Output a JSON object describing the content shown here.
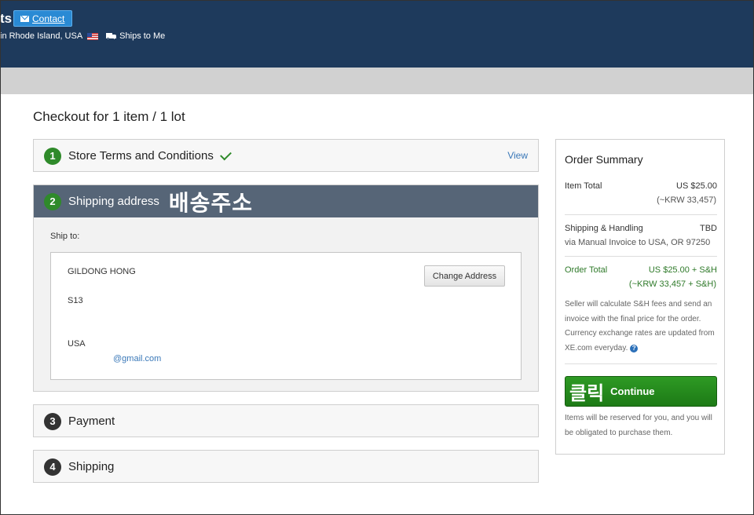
{
  "header": {
    "brand_fragment": "ts",
    "contact_label": "Contact",
    "location": "in Rhode Island, USA",
    "ships_to": "Ships to Me"
  },
  "page_title": "Checkout for 1 item / 1 lot",
  "steps": [
    {
      "number": "1",
      "title": "Store Terms and Conditions",
      "link": "View"
    },
    {
      "number": "2",
      "title": "Shipping address",
      "annotation": "배송주소"
    },
    {
      "number": "3",
      "title": "Payment"
    },
    {
      "number": "4",
      "title": "Shipping"
    }
  ],
  "shipping": {
    "ship_to_label": "Ship to:",
    "name": "GILDONG HONG",
    "line2": "S13",
    "country": "USA",
    "email": "@gmail.com",
    "change_button": "Change Address"
  },
  "summary": {
    "title": "Order Summary",
    "item_total_label": "Item Total",
    "item_total_value": "US $25.00",
    "item_total_krw": "(~KRW 33,457)",
    "shipping_label": "Shipping & Handling",
    "shipping_value": "TBD",
    "shipping_via": "via Manual Invoice to USA, OR 97250",
    "order_total_label": "Order Total",
    "order_total_value": "US $25.00 + S&H",
    "order_total_krw": "(~KRW 33,457 + S&H)",
    "note": "Seller will calculate S&H fees and send an invoice with the final price for the order. Currency exchange rates are updated from XE.com everyday.",
    "help_glyph": "?",
    "continue_annotation": "클릭",
    "continue_label": "Continue",
    "reserve_note": "Items will be reserved for you, and you will be obligated to purchase them."
  },
  "colors": {
    "header_bg": "#1e3a5c",
    "active_step_bg": "#566577",
    "continue_green": "#1d7a16",
    "link_blue": "#3a78b8"
  }
}
